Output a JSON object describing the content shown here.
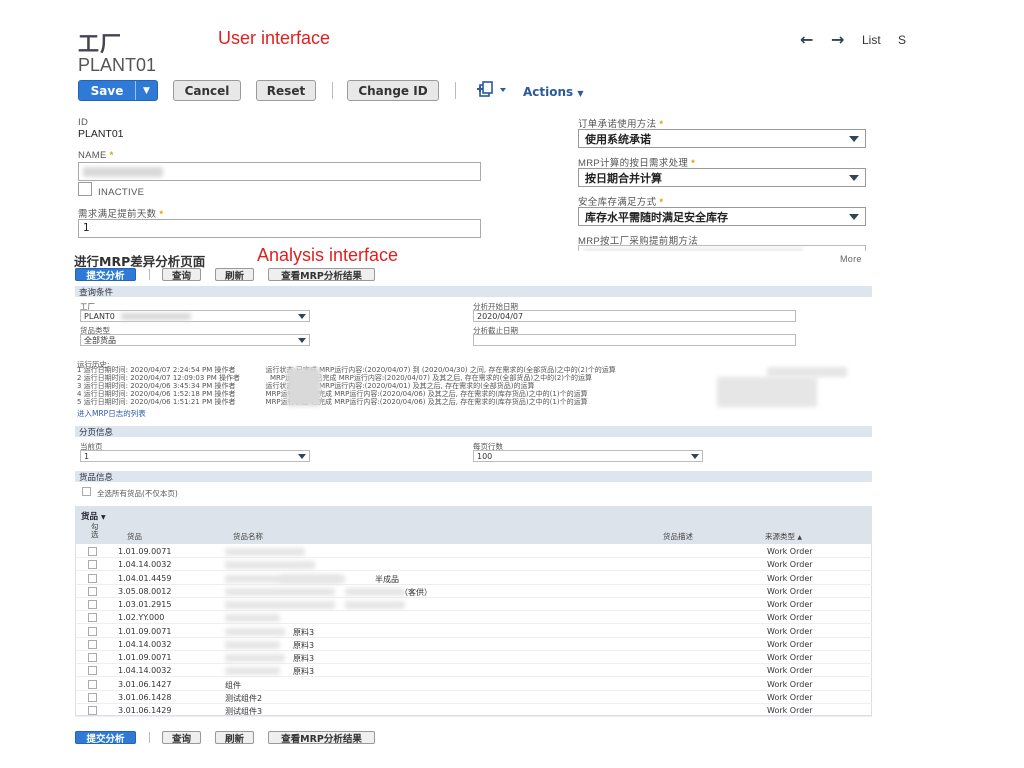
{
  "header": {
    "record_type": "工厂",
    "record_name": "PLANT01",
    "annotation_ui": "User interface",
    "annotation_analysis": "Analysis interface",
    "nav": {
      "back_icon": "←",
      "forward_icon": "→",
      "list_label": "List",
      "search_label": "S"
    }
  },
  "toolbar": {
    "save": "Save",
    "cancel": "Cancel",
    "reset": "Reset",
    "change_id": "Change ID",
    "actions": "Actions"
  },
  "form": {
    "id_label": "ID",
    "id_value": "PLANT01",
    "name_label": "NAME",
    "inactive_label": "INACTIVE",
    "lead_days_label": "需求满足提前天数",
    "lead_days_value": "1",
    "commit_method_label": "订单承诺使用方法",
    "commit_method_value": "使用系统承诺",
    "daily_demand_label": "MRP计算的按日需求处理",
    "daily_demand_value": "按日期合并计算",
    "safety_stock_label": "安全库存满足方式",
    "safety_stock_value": "库存水平需随时满足安全库存",
    "purchase_lead_label": "MRP按工厂采购提前期方法",
    "more_label": "More"
  },
  "analysis": {
    "title": "进行MRP差异分析页面",
    "buttons": {
      "submit": "提交分析",
      "query": "查询",
      "refresh": "刷新",
      "view_results": "查看MRP分析结果"
    },
    "query_section": "查询条件",
    "plant_label": "工厂",
    "plant_value": "PLANT0",
    "item_type_label": "货品类型",
    "item_type_value": "全部货品",
    "start_date_label": "分析开始日期",
    "start_date_value": "2020/04/07",
    "end_date_label": "分析截止日期",
    "end_date_value": "",
    "history_label": "运行历史:",
    "history": [
      "1 运行日期时间: 2020/04/07 2:24:54 PM 操作者",
      "运行状态:已完成 MRP运行内容:(2020/04/07) 到 (2020/04/30) 之间, 存在需求的(全部货品)之中的(2)个的运算",
      "2 运行日期时间: 2020/04/07 12:09:03 PM 操作者",
      "MRP运行状态:已完成 MRP运行内容:(2020/04/07) 及其之后, 存在需求的(全部货品)之中的(2)个的运算",
      "3 运行日期时间: 2020/04/06 3:45:34 PM 操作者",
      "运行状态:已完成 MRP运行内容:(2020/04/01) 及其之后, 存在需求的(全部货品)的运算",
      "4 运行日期时间: 2020/04/06 1:52:18 PM 操作者",
      "MRP运行状态:已完成 MRP运行内容:(2020/04/06) 及其之后, 存在需求的(库存货品)之中的(1)个的运算",
      "5 运行日期时间: 2020/04/06 1:51:21 PM 操作者",
      "MRP运行状态:已完成 MRP运行内容:(2020/04/06) 及其之后, 存在需求的(库存货品)之中的(1)个的运算"
    ],
    "history_link": "进入MRP日志的列表",
    "paging_section": "分页信息",
    "current_page_label": "当前页",
    "current_page_value": "1",
    "per_page_label": "每页行数",
    "per_page_value": "100",
    "item_section": "货品信息",
    "select_all_label": "全选所有货品(不仅本页)"
  },
  "table": {
    "tab_label": "货品",
    "columns": {
      "select": "勾选",
      "item": "货品",
      "item_name": "货品名称",
      "item_desc": "货品描述",
      "source_type": "来源类型"
    },
    "sort_indicator": "▲",
    "rows": [
      {
        "code": "1.01.09.0071",
        "name": "",
        "source": "Work Order"
      },
      {
        "code": "1.04.14.0032",
        "name": "",
        "source": "Work Order"
      },
      {
        "code": "1.04.01.4459",
        "name": "半成品",
        "source": "Work Order"
      },
      {
        "code": "3.05.08.0012",
        "name": "（客供）",
        "source": "Work Order"
      },
      {
        "code": "1.03.01.2915",
        "name": "",
        "source": "Work Order"
      },
      {
        "code": "1.02.YY.000",
        "name": "",
        "source": "Work Order"
      },
      {
        "code": "1.01.09.0071",
        "name": "原料3",
        "source": "Work Order"
      },
      {
        "code": "1.04.14.0032",
        "name": "原料3",
        "source": "Work Order"
      },
      {
        "code": "1.01.09.0071",
        "name": "原料3",
        "source": "Work Order"
      },
      {
        "code": "1.04.14.0032",
        "name": "原料3",
        "source": "Work Order"
      },
      {
        "code": "3.01.06.1427",
        "name": "组件",
        "source": "Work Order"
      },
      {
        "code": "3.01.06.1428",
        "name": "测试组件2",
        "source": "Work Order"
      },
      {
        "code": "3.01.06.1429",
        "name": "测试组件3",
        "source": "Work Order"
      }
    ]
  },
  "colors": {
    "primary": "#2f7ad6",
    "section_bar": "#dde5ef",
    "annotation": "#e02020",
    "required": "#e5a000"
  }
}
